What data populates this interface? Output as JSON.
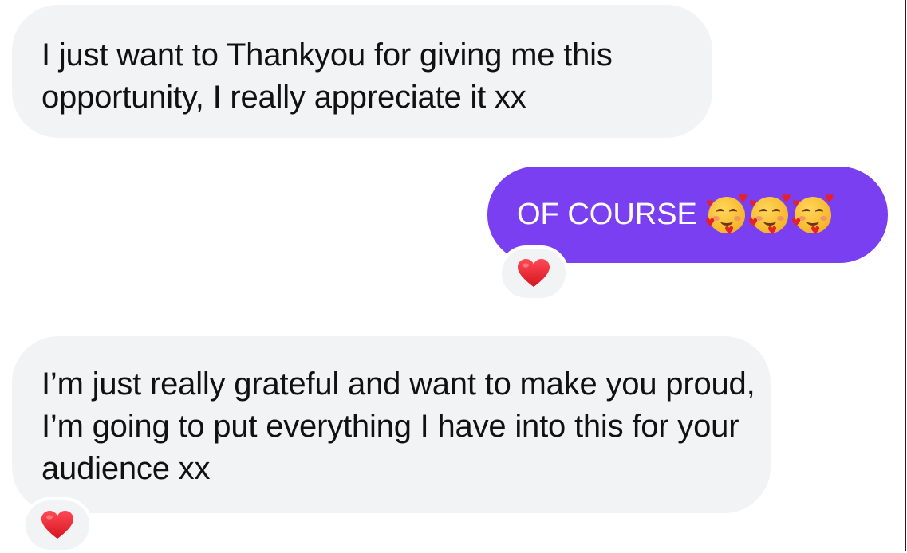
{
  "conversation": {
    "messages": [
      {
        "direction": "received",
        "text": "I just want to Thankyou for giving me this opportunity, I really appreciate it xx",
        "reaction": null
      },
      {
        "direction": "sent",
        "text": "OF COURSE",
        "emojis": [
          "smiling-face-with-hearts-icon",
          "smiling-face-with-hearts-icon",
          "smiling-face-with-hearts-icon"
        ],
        "reaction": "red-heart-icon"
      },
      {
        "direction": "received",
        "text": "I’m just really grateful and want to make you proud, I’m going to put everything I have into this for your audience xx",
        "reaction": "red-heart-icon"
      }
    ]
  },
  "colors": {
    "received_bubble": "#f2f3f5",
    "sent_bubble": "#7b3ff2",
    "reaction_heart": "#e3202c",
    "background": "#ffffff"
  }
}
